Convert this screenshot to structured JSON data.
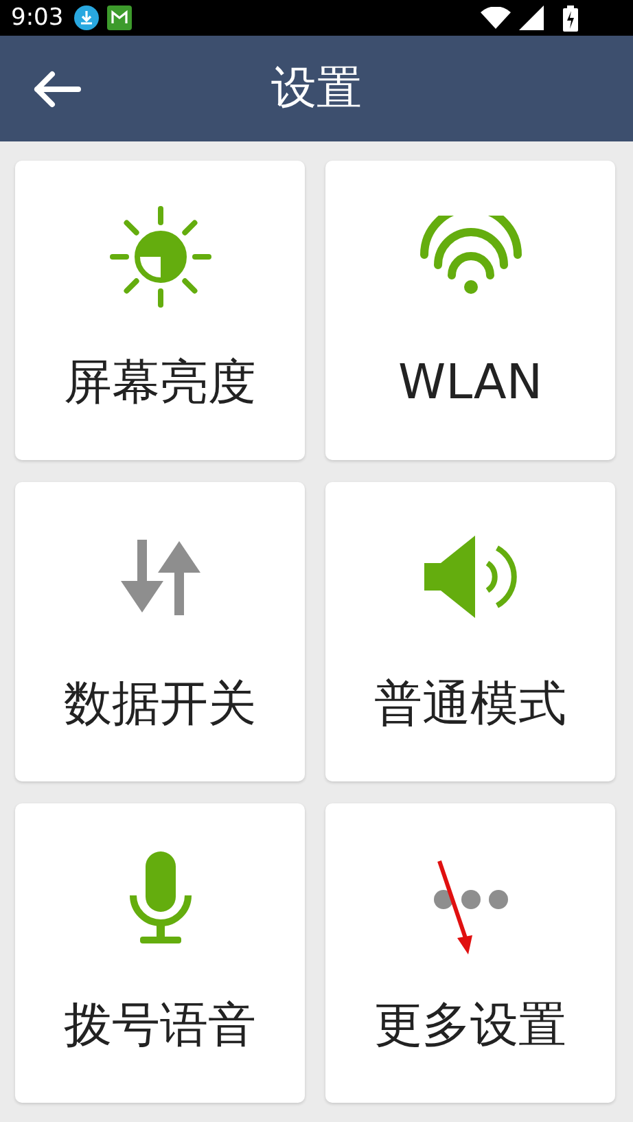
{
  "status_bar": {
    "time": "9:03"
  },
  "header": {
    "title": "设置"
  },
  "tiles": [
    {
      "kind": "brightness",
      "label": "屏幕亮度",
      "on": true
    },
    {
      "kind": "wifi",
      "label": "WLAN",
      "on": true
    },
    {
      "kind": "data",
      "label": "数据开关",
      "on": false
    },
    {
      "kind": "sound",
      "label": "普通模式",
      "on": true
    },
    {
      "kind": "mic",
      "label": "拨号语音",
      "on": true
    },
    {
      "kind": "more",
      "label": "更多设置",
      "on": false
    }
  ]
}
